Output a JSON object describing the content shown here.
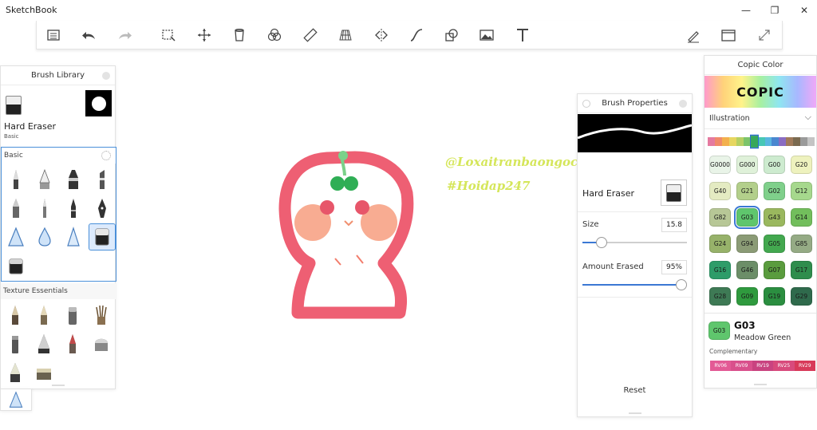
{
  "app": {
    "title": "SketchBook"
  },
  "window": {
    "minimize": "—",
    "restore": "❐",
    "close": "✕"
  },
  "toolbar_icons": [
    "list-icon",
    "undo-icon",
    "redo-icon",
    "select-icon",
    "transform-icon",
    "bucket-icon",
    "blend-icon",
    "ruler-icon",
    "perspective-icon",
    "symmetry-icon",
    "curve-icon",
    "shape-icon",
    "image-icon",
    "text-icon",
    "pen-icon",
    "window-icon",
    "fullscreen-icon"
  ],
  "brush_library": {
    "title": "Brush Library",
    "current_name": "Hard Eraser",
    "current_set": "Basic",
    "section_basic": "Basic",
    "section_texture": "Texture Essentials"
  },
  "brush_properties": {
    "title": "Brush Properties",
    "brush_name": "Hard Eraser",
    "size_label": "Size",
    "size_value": "15.8",
    "size_fraction": 0.18,
    "amount_label": "Amount Erased",
    "amount_value": "95%",
    "amount_fraction": 0.95,
    "reset_label": "Reset"
  },
  "canvas": {
    "watermark_line1": "@Loxaitranbaongoc",
    "watermark_line2": "#Hoidap247"
  },
  "copic": {
    "title": "Copic Color",
    "logo": "COPIC",
    "palette": "Illustration",
    "strip_colors": [
      "#e57aa0",
      "#f08a6a",
      "#f3b04d",
      "#e7d660",
      "#b6cf63",
      "#7cc46a",
      "#38a85a",
      "#47c7b5",
      "#59b6e0",
      "#4a87d0",
      "#8a6cc2",
      "#a07a5a",
      "#7a6a50",
      "#9a9a9a",
      "#c4c4c4"
    ],
    "strip_selected": 6,
    "swatches": [
      {
        "code": "G0000",
        "color": "#e9f4e8"
      },
      {
        "code": "G000",
        "color": "#dff1d9"
      },
      {
        "code": "G00",
        "color": "#cdebcf"
      },
      {
        "code": "G20",
        "color": "#eef2be"
      },
      {
        "code": "G40",
        "color": "#e4ebc2"
      },
      {
        "code": "G21",
        "color": "#b3cf8b"
      },
      {
        "code": "G02",
        "color": "#7fd08b"
      },
      {
        "code": "G12",
        "color": "#a6d88d"
      },
      {
        "code": "G82",
        "color": "#b7c796"
      },
      {
        "code": "G03",
        "color": "#5fc66d"
      },
      {
        "code": "G43",
        "color": "#9ab85e"
      },
      {
        "code": "G14",
        "color": "#72be5c"
      },
      {
        "code": "G24",
        "color": "#97b26a"
      },
      {
        "code": "G94",
        "color": "#8b9b76"
      },
      {
        "code": "G05",
        "color": "#43a84f"
      },
      {
        "code": "G85",
        "color": "#95ab85"
      },
      {
        "code": "G16",
        "color": "#2e9c69"
      },
      {
        "code": "G46",
        "color": "#6c8e68"
      },
      {
        "code": "G07",
        "color": "#5a9c3e"
      },
      {
        "code": "G17",
        "color": "#2f8d4d"
      },
      {
        "code": "G28",
        "color": "#3e7a55"
      },
      {
        "code": "G09",
        "color": "#2f9a3e"
      },
      {
        "code": "G19",
        "color": "#2b8e40"
      },
      {
        "code": "G29",
        "color": "#2f6a4c"
      }
    ],
    "selected_index": 9,
    "selected": {
      "code": "G03",
      "name": "Meadow Green",
      "color": "#5fc66d"
    },
    "complementary_label": "Complementary",
    "complementary": [
      {
        "code": "RV06",
        "color": "#e35a95"
      },
      {
        "code": "RV09",
        "color": "#d9508c"
      },
      {
        "code": "RV19",
        "color": "#c94380"
      },
      {
        "code": "RV25",
        "color": "#d84a7c"
      },
      {
        "code": "RV29",
        "color": "#d83a5a"
      }
    ]
  }
}
